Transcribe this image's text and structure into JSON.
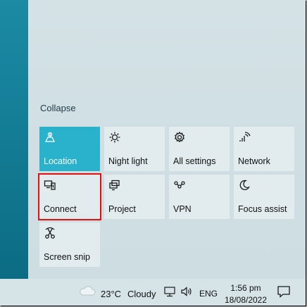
{
  "action_center": {
    "collapse_label": "Collapse",
    "tiles": [
      {
        "label": "Location",
        "icon": "location-icon",
        "state": "active"
      },
      {
        "label": "Night light",
        "icon": "brightness-icon",
        "state": "off"
      },
      {
        "label": "All settings",
        "icon": "gear-icon",
        "state": "off"
      },
      {
        "label": "Network",
        "icon": "network-icon",
        "state": "off"
      },
      {
        "label": "Connect",
        "icon": "connect-icon",
        "state": "off",
        "highlighted": true
      },
      {
        "label": "Project",
        "icon": "project-icon",
        "state": "off"
      },
      {
        "label": "VPN",
        "icon": "vpn-icon",
        "state": "off"
      },
      {
        "label": "Focus assist",
        "icon": "moon-icon",
        "state": "off"
      },
      {
        "label": "Screen snip",
        "icon": "snip-icon",
        "state": "off"
      }
    ]
  },
  "taskbar": {
    "temperature": "23°C",
    "weather": "Cloudy",
    "language": "ENG",
    "time": "1:56 pm",
    "date": "18/08/2022"
  },
  "colors": {
    "accent": "#2ab1cb",
    "highlight_border": "#e01010"
  }
}
